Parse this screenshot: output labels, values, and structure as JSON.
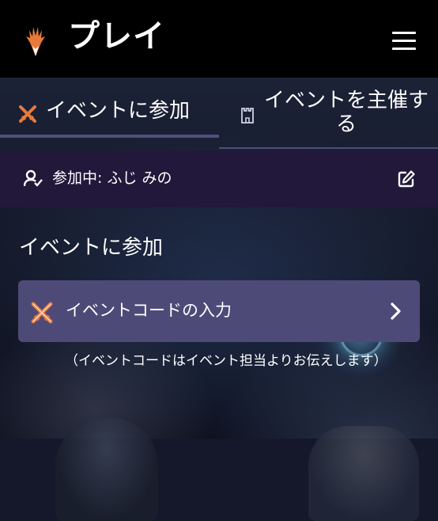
{
  "header": {
    "title": "プレイ",
    "logo_icon": "mtg-planeswalker-logo-icon",
    "menu_icon": "hamburger-menu-icon"
  },
  "tabs": [
    {
      "label": "イベントに参加",
      "icon": "crossed-swords-icon",
      "active": true
    },
    {
      "label": "イベントを主催する",
      "icon": "castle-tower-icon",
      "active": false
    }
  ],
  "status": {
    "text": "参加中: ふじ みの",
    "icon": "user-check-icon",
    "edit_icon": "edit-pencil-icon"
  },
  "section": {
    "title": "イベントに参加"
  },
  "code_entry": {
    "label": "イベントコードの入力",
    "icon": "crossed-swords-icon",
    "chevron_icon": "chevron-right-icon"
  },
  "note": "（イベントコードはイベント担当よりお伝えします）",
  "colors": {
    "accent_orange": "#e8793a",
    "tab_underline": "#4f4f7e",
    "button_bg": "#4e4a78",
    "status_bg": "#23183c",
    "topbar_bg": "#000000"
  }
}
